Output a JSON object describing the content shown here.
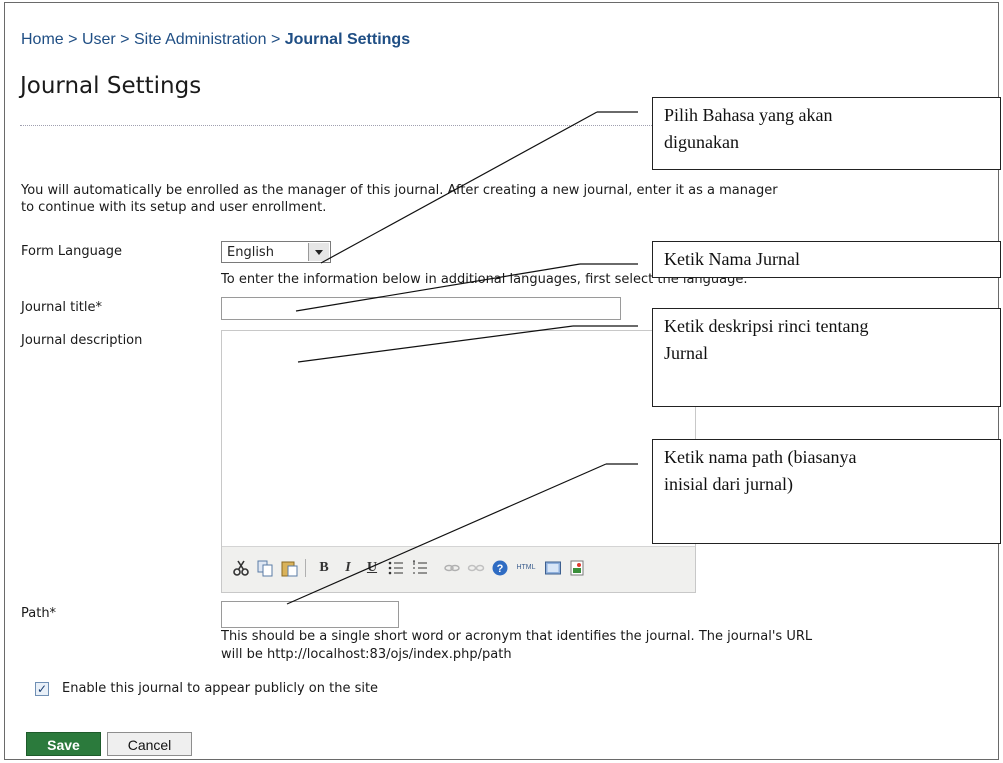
{
  "breadcrumb": {
    "home": "Home",
    "user": "User",
    "site_admin": "Site Administration",
    "current": "Journal Settings",
    "separator": ">"
  },
  "page_title": "Journal Settings",
  "intro": {
    "line1": "You will automatically be enrolled as the manager of this journal. After creating a new journal, enter it as a manager",
    "line2": "to continue with its setup and user enrollment."
  },
  "form": {
    "language_label": "Form Language",
    "language_value": "English",
    "language_hint": "To enter the information below in additional languages, first select the language.",
    "title_label": "Journal title*",
    "title_value": "",
    "description_label": "Journal description",
    "description_value": "",
    "path_label": "Path*",
    "path_value": "",
    "path_hint_line1": "This should be a single short word or acronym that identifies the journal. The journal's URL",
    "path_hint_line2": "will be http://localhost:83/ojs/index.php/path",
    "enable_label": "Enable this journal to appear publicly on the site",
    "enable_checked": true
  },
  "editor_toolbar": {
    "cut": "cut-icon",
    "copy": "copy-icon",
    "paste": "paste-icon",
    "bold": "B",
    "italic": "I",
    "underline": "U",
    "bullet_list": "bullet-list-icon",
    "numbered_list": "numbered-list-icon",
    "link": "link-icon",
    "unlink": "unlink-icon",
    "help": "help-icon",
    "html": "HTML",
    "fullscreen": "fullscreen-icon",
    "image": "image-icon"
  },
  "buttons": {
    "save": "Save",
    "cancel": "Cancel"
  },
  "callouts": {
    "language_1": "Pilih Bahasa yang akan",
    "language_2": "digunakan",
    "title": "Ketik Nama Jurnal",
    "description_1": "Ketik deskripsi rinci tentang",
    "description_2": "Jurnal",
    "path_1": "Ketik nama path (biasanya",
    "path_2": "inisial dari jurnal)"
  },
  "colors": {
    "breadcrumb": "#1f4e84",
    "save_button": "#2b7a3c"
  }
}
